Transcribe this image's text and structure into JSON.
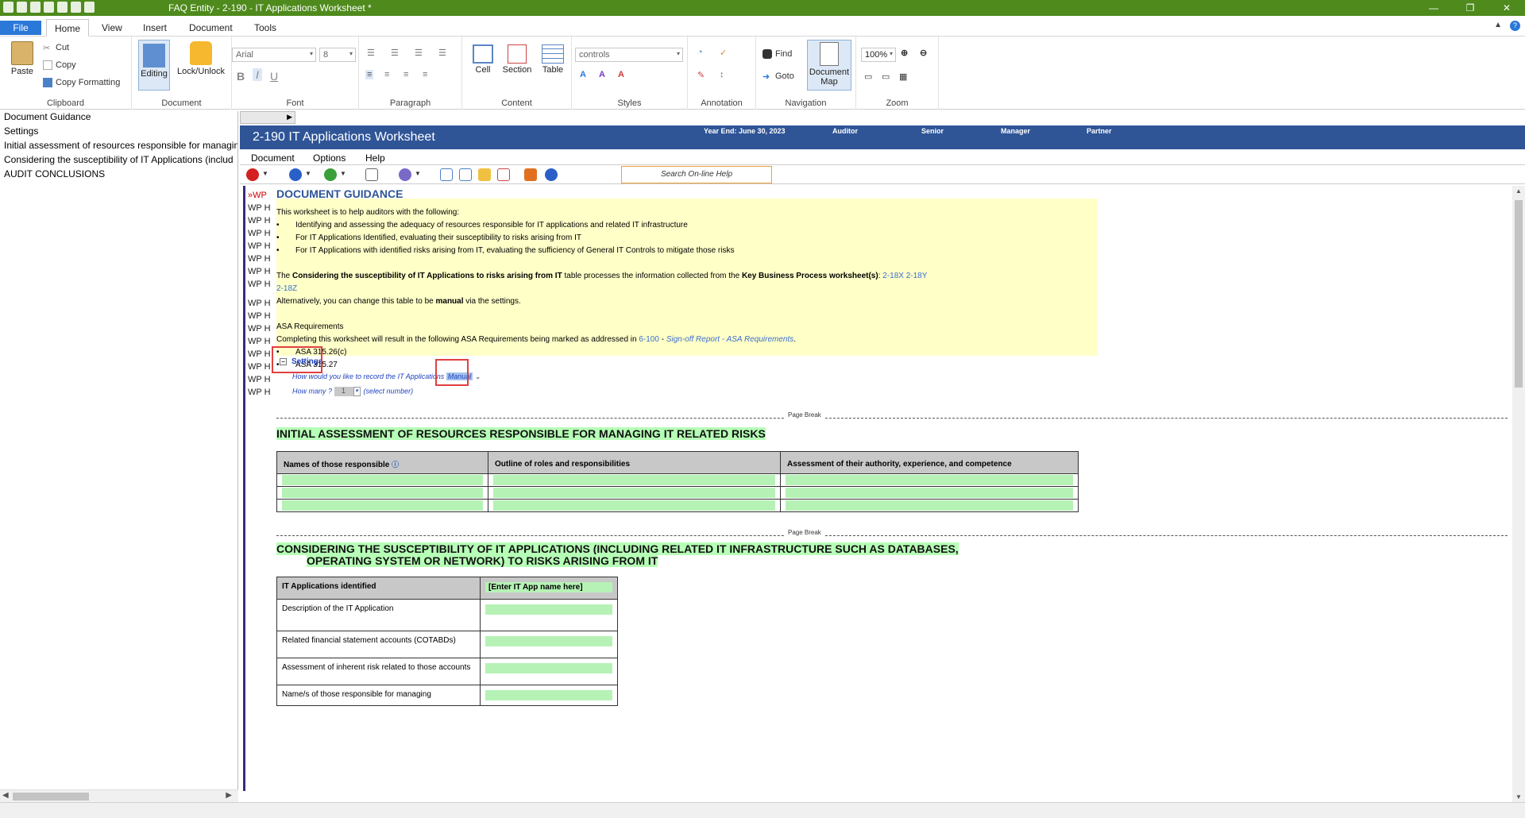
{
  "window": {
    "title": "FAQ Entity - 2-190 - IT Applications Worksheet *"
  },
  "ribbon_tabs": [
    "File",
    "Home",
    "View",
    "Insert",
    "Document",
    "Tools"
  ],
  "ribbon": {
    "clipboard": {
      "label": "Clipboard",
      "paste": "Paste",
      "cut": "Cut",
      "copy": "Copy",
      "copy_formatting": "Copy Formatting"
    },
    "document": {
      "label": "Document",
      "editing": "Editing",
      "lock_unlock": "Lock/Unlock"
    },
    "font": {
      "label": "Font",
      "font_name": "Arial",
      "font_size": "8",
      "bold": "B",
      "italic": "I",
      "underline": "U"
    },
    "paragraph": {
      "label": "Paragraph"
    },
    "content": {
      "label": "Content",
      "cell": "Cell",
      "section": "Section",
      "table": "Table"
    },
    "styles": {
      "label": "Styles",
      "style_value": "controls"
    },
    "annotation": {
      "label": "Annotation"
    },
    "navigation": {
      "label": "Navigation",
      "find": "Find",
      "goto": "Goto",
      "document_map": "Document Map"
    },
    "zoom": {
      "label": "Zoom",
      "zoom_value": "100%"
    }
  },
  "nav_pane": {
    "items": [
      "Document Guidance",
      "Settings",
      "Initial assessment of resources responsible for managin",
      "Considering the susceptibility of IT Applications (includ",
      "AUDIT CONCLUSIONS"
    ]
  },
  "doc_header": {
    "title": "2-190 IT Applications Worksheet",
    "year_end": "Year End: June 30, 2023",
    "auditor": "Auditor",
    "senior": "Senior",
    "manager": "Manager",
    "partner": "Partner"
  },
  "doc_menu": [
    "Document",
    "Options",
    "Help"
  ],
  "doc_toolbar": {
    "search_placeholder": "Search On-line Help"
  },
  "wp_column": [
    "»WP",
    "WP H",
    "WP H",
    "WP H",
    "WP H",
    "WP H",
    "WP H",
    "WP H",
    "WP H",
    "WP H",
    "WP H",
    "WP H",
    "WP H",
    "WP H",
    "WP H",
    "WP H"
  ],
  "guidance": {
    "heading": "DOCUMENT GUIDANCE",
    "intro": "This worksheet is to help auditors with the following:",
    "bullets": [
      "Identifying and assessing the adequacy of resources responsible for IT applications and related IT infrastructure",
      "For IT Applications Identified, evaluating their susceptibility to risks arising from IT",
      "For IT Applications with identified risks arising from IT, evaluating the sufficiency of General IT Controls to mitigate those risks"
    ],
    "p2_a": "The ",
    "p2_b": "Considering the susceptibility of IT Applications to risks arising from IT",
    "p2_c": " table processes the information collected from the ",
    "p2_d": "Key Business Process worksheet(s)",
    "p2_e": ": ",
    "p2_link1": "2-18X 2-18Y",
    "p2_link2": "2-18Z",
    "p3_a": "Alternatively, you can change this table to be ",
    "p3_b": "manual",
    "p3_c": " via the settings.",
    "asa_title": "ASA Requirements",
    "asa_text": "Completing this worksheet will result in the following ASA Requirements being marked as addressed in ",
    "asa_link": "6-100",
    "asa_dash": " - ",
    "asa_ilink": "Sign-off Report - ASA Requirements",
    "asa_dot": ".",
    "asa_bullets": [
      "ASA 315.26(c)",
      "ASA 315.27"
    ]
  },
  "settings": {
    "label": "Settings",
    "q1": "How would you like to record the IT Applications",
    "q1_value": "Manual",
    "q2": "How many ?",
    "q2_value": "1",
    "q2_hint": "(select number)"
  },
  "page_break_label": "Page Break",
  "section1": {
    "title": "INITIAL ASSESSMENT OF RESOURCES RESPONSIBLE FOR MANAGING IT RELATED RISKS",
    "columns": [
      "Names of those responsible",
      "Outline of roles and responsibilities",
      "Assessment of their authority, experience, and competence"
    ]
  },
  "section2": {
    "title_line1": "CONSIDERING THE SUSCEPTIBILITY OF IT APPLICATIONS (INCLUDING RELATED IT INFRASTRUCTURE SUCH AS DATABASES,",
    "title_line2": "OPERATING SYSTEM OR NETWORK) TO RISKS ARISING FROM IT",
    "header_label": "IT Applications identified",
    "header_value": "[Enter IT App name here]",
    "rows": [
      "Description of the IT Application",
      "Related financial statement accounts (COTABDs)",
      "Assessment of inherent risk related to those accounts",
      "Name/s of those responsible for managing"
    ]
  },
  "colors": {
    "title_bar": "#4e8a1c",
    "doc_header": "#2f5597",
    "guidance_bg": "#ffffc8",
    "input_green": "#b6f2b6",
    "highlight_box": "#e04040"
  }
}
